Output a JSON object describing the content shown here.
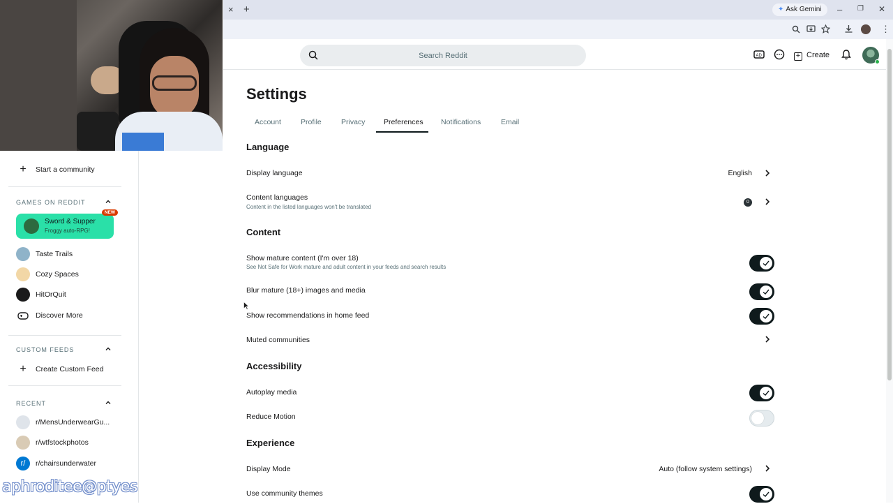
{
  "browser": {
    "close_tab_glyph": "×",
    "new_tab_glyph": "+",
    "ask_gemini_label": "Ask Gemini",
    "window_minimize": "–",
    "window_restore": "❐",
    "window_close": "✕"
  },
  "header": {
    "search_placeholder": "Search Reddit",
    "create_label": "Create"
  },
  "sidebar": {
    "start_community": "Start a community",
    "games_header": "GAMES ON REDDIT",
    "featured_game": {
      "title": "Sword & Supper",
      "subtitle": "Froggy auto-RPG!",
      "badge": "NEW"
    },
    "games": [
      "Taste Trails",
      "Cozy Spaces",
      "HitOrQuit",
      "Discover More"
    ],
    "custom_feeds_header": "CUSTOM FEEDS",
    "create_custom_feed": "Create Custom Feed",
    "recent_header": "RECENT",
    "recent": [
      "r/MensUnderwearGu...",
      "r/wtfstockphotos",
      "r/chairsunderwater"
    ],
    "watermark": "aphroditee@ptyes"
  },
  "settings": {
    "title": "Settings",
    "tabs": [
      "Account",
      "Profile",
      "Privacy",
      "Preferences",
      "Notifications",
      "Email"
    ],
    "active_tab": "Preferences",
    "language": {
      "heading": "Language",
      "display_language_label": "Display language",
      "display_language_value": "English",
      "content_languages_label": "Content languages",
      "content_languages_desc": "Content in the listed languages won't be translated",
      "content_languages_count": "0"
    },
    "content": {
      "heading": "Content",
      "mature_label": "Show mature content (I'm over 18)",
      "mature_desc": "See Not Safe for Work mature and adult content in your feeds and search results",
      "mature_on": true,
      "blur_label": "Blur mature (18+) images and media",
      "blur_on": true,
      "recs_label": "Show recommendations in home feed",
      "recs_on": true,
      "muted_label": "Muted communities"
    },
    "accessibility": {
      "heading": "Accessibility",
      "autoplay_label": "Autoplay media",
      "autoplay_on": true,
      "reduce_motion_label": "Reduce Motion",
      "reduce_motion_on": false
    },
    "experience": {
      "heading": "Experience",
      "display_mode_label": "Display Mode",
      "display_mode_value": "Auto (follow system settings)",
      "community_themes_label": "Use community themes",
      "community_themes_on": true
    }
  },
  "colors": {
    "toggle_on": "#0f1a1c",
    "toggle_off": "#e5ebee",
    "featured_game_bg": "#2ae0a8",
    "new_badge": "#d93a00"
  }
}
